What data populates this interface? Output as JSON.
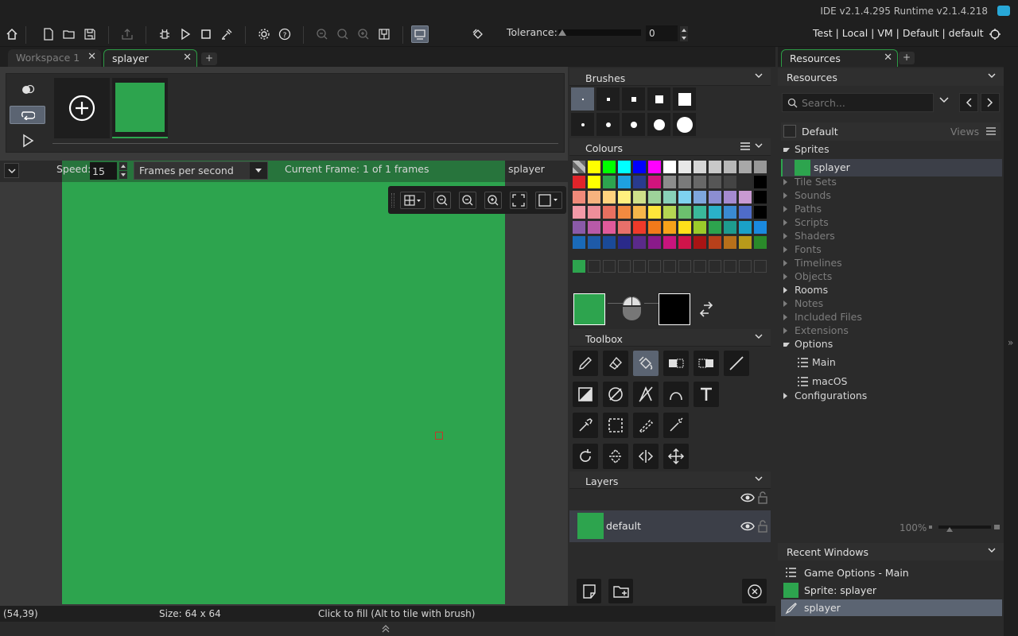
{
  "app": {
    "version": "IDE v2.1.4.295 Runtime v2.1.4.218"
  },
  "toolbar": {
    "tolerance_label": "Tolerance:",
    "tolerance_value": "0",
    "targets": "Test | Local | VM | Default | default"
  },
  "tabs": [
    {
      "label": "Workspace 1"
    },
    {
      "label": "splayer"
    }
  ],
  "timeline": {
    "speed_label": "Speed:",
    "speed_value": "15",
    "fps_option": "Frames per second",
    "current_frame": "Current Frame: 1 of 1 frames",
    "sprite_name": "splayer"
  },
  "status": {
    "coords": "(54,39)",
    "size": "Size: 64 x 64",
    "hint": "Click to fill (Alt to tile with brush)"
  },
  "panels": {
    "brushes": "Brushes",
    "colours": "Colours",
    "toolbox": "Toolbox",
    "layers": "Layers"
  },
  "layers": [
    {
      "name": "default"
    }
  ],
  "colors": {
    "primary": "#2da44e",
    "secondary": "#000000",
    "accent_green": "#2da44e",
    "selection": "#5b6472",
    "palette": [
      [
        "#8c8c8c",
        "#ffff00",
        "#00ff00",
        "#00ffff",
        "#0000ff",
        "#ff00ff",
        "#ffffff",
        "#e8e8e8",
        "#d6d6d6",
        "#c8c8c8",
        "#b8b8b8",
        "#a8a8a8",
        "#989898"
      ],
      [
        "#e0242a",
        "#ffff00",
        "#2da44e",
        "#1ea1e0",
        "#293b8e",
        "#d0147d",
        "#8c8c8c",
        "#7a7a7a",
        "#686868",
        "#565656",
        "#444444",
        "#2c2c2c",
        "#000000"
      ],
      [
        "#f08a7a",
        "#f7b37e",
        "#ffd37e",
        "#fff07e",
        "#cfe08a",
        "#9ed39a",
        "#88d0b8",
        "#7ed2ef",
        "#7ea6dd",
        "#8c8ed2",
        "#a58ad0",
        "#c89ad2",
        "#000000"
      ],
      [
        "#f29aa8",
        "#ee8e9a",
        "#e97060",
        "#f28a40",
        "#f6b64a",
        "#ffe63a",
        "#b5d652",
        "#6cc06e",
        "#3ab89a",
        "#2ab1c8",
        "#3a8ad2",
        "#4f6cc8",
        "#000000"
      ],
      [
        "#8a5aa8",
        "#b85aa8",
        "#e05a9a",
        "#e8706a",
        "#ee3a2a",
        "#f27a1a",
        "#f7a21a",
        "#ffe01a",
        "#9bcb2a",
        "#2da44e",
        "#1e9b8e",
        "#1aa1c8",
        "#1a8ae0"
      ],
      [
        "#1a6ab8",
        "#1e5aa8",
        "#1a4a98",
        "#2a2a8a",
        "#5a2a8a",
        "#8a1a8a",
        "#c8147d",
        "#d0144a",
        "#a81414",
        "#b8401a",
        "#b8701a",
        "#b89a1a",
        "#2a8a2a"
      ]
    ],
    "palette_custom": [
      "#2da44e",
      "",
      "",
      "",
      "",
      "",
      "",
      "",
      "",
      "",
      "",
      "",
      ""
    ]
  },
  "resources": {
    "tab_label": "Resources",
    "header": "Resources",
    "search_placeholder": "Search...",
    "group": "Default",
    "views_label": "Views",
    "tree": [
      {
        "label": "Sprites",
        "open": true
      },
      {
        "label": "splayer",
        "child": true
      },
      {
        "label": "Tile Sets"
      },
      {
        "label": "Sounds"
      },
      {
        "label": "Paths"
      },
      {
        "label": "Scripts"
      },
      {
        "label": "Shaders"
      },
      {
        "label": "Fonts"
      },
      {
        "label": "Timelines"
      },
      {
        "label": "Objects"
      },
      {
        "label": "Rooms",
        "bold": true
      },
      {
        "label": "Notes"
      },
      {
        "label": "Included Files"
      },
      {
        "label": "Extensions"
      },
      {
        "label": "Options",
        "open": true
      },
      {
        "label": "Main",
        "child": true
      },
      {
        "label": "macOS",
        "child": true
      },
      {
        "label": "Configurations",
        "bold": true
      }
    ],
    "zoom": "100%"
  },
  "recent": {
    "header": "Recent Windows",
    "items": [
      {
        "label": "Game Options - Main"
      },
      {
        "label": "Sprite: splayer"
      },
      {
        "label": "splayer"
      }
    ]
  }
}
